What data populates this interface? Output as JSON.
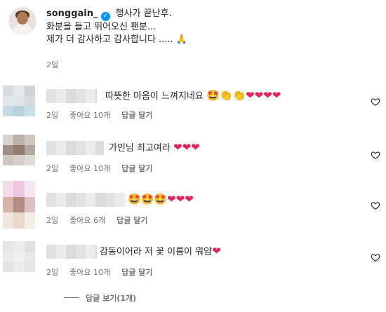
{
  "post": {
    "username": "songgain_",
    "caption_line1": "행사가 끝난후.",
    "caption_line2": "화분을 들고 뛰어오신 팬분...",
    "caption_line3": "제가 더 감사하고 감사합니다 .....",
    "caption_emoji": "🙏",
    "time": "2일"
  },
  "comments": [
    {
      "text": "따뜻한 마음이 느껴지네요",
      "emojis": "🤩👏👏❤❤❤❤",
      "time": "2일",
      "likes": "좋아요 10개",
      "reply": "답글 달기"
    },
    {
      "text": "가인님 최고여라",
      "emojis": "❤❤❤",
      "time": "2일",
      "likes": "좋아요 10개",
      "reply": "답글 달기"
    },
    {
      "text": "",
      "emojis": "🤩🤩🤩❤❤❤",
      "time": "2일",
      "likes": "좋아요 6개",
      "reply": "답글 달기"
    },
    {
      "text": "감동이어라 저 꽃 이름이 뭐얌",
      "emojis": "❤",
      "time": "2일",
      "likes": "좋아요 10개",
      "reply": "답글 달기"
    }
  ],
  "view_replies": "답글 보기(1개)",
  "colors": {
    "heart": "#e0245e",
    "verified": "#0095f6",
    "meta_text": "#737373"
  }
}
